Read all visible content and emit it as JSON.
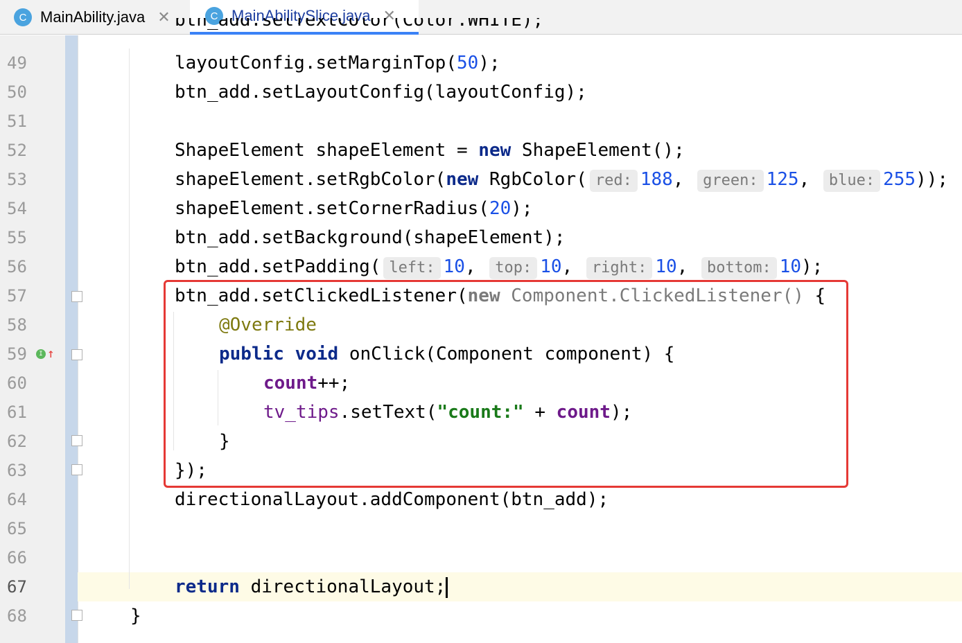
{
  "tabs": [
    {
      "icon": "c-class-icon",
      "icon_letter": "C",
      "label": "MainAbility.java",
      "close": "✕",
      "active": false
    },
    {
      "icon": "c-class-icon",
      "icon_letter": "C",
      "label": "MainAbilitySlice.java",
      "close": "✕",
      "active": true
    }
  ],
  "editor": {
    "current_line": "67",
    "lines": [
      {
        "num": "49"
      },
      {
        "num": "50"
      },
      {
        "num": "51"
      },
      {
        "num": "52"
      },
      {
        "num": "53"
      },
      {
        "num": "54"
      },
      {
        "num": "55"
      },
      {
        "num": "56"
      },
      {
        "num": "57"
      },
      {
        "num": "58"
      },
      {
        "num": "59"
      },
      {
        "num": "60"
      },
      {
        "num": "61"
      },
      {
        "num": "62"
      },
      {
        "num": "63"
      },
      {
        "num": "64"
      },
      {
        "num": "65"
      },
      {
        "num": "66"
      },
      {
        "num": "67"
      },
      {
        "num": "68"
      }
    ],
    "code": {
      "l48": "btn_add.setTextColor(Color.WHITE);",
      "l49a": "layoutConfig.setMarginTop(",
      "l49n": "50",
      "l49b": ");",
      "l50": "btn_add.setLayoutConfig(layoutConfig);",
      "l52a": "ShapeElement shapeElement = ",
      "l52k": "new",
      "l52b": " ShapeElement();",
      "l53a": "shapeElement.setRgbColor(",
      "l53k": "new",
      "l53b": " RgbColor(",
      "l53h1": "red:",
      "l53n1": "188",
      "l53h2": "green:",
      "l53n2": "125",
      "l53h3": "blue:",
      "l53n3": "255",
      "l53c": "));",
      "l54a": "shapeElement.setCornerRadius(",
      "l54n": "20",
      "l54b": ");",
      "l55": "btn_add.setBackground(shapeElement);",
      "l56a": "btn_add.setPadding(",
      "l56h1": "left:",
      "l56n1": "10",
      "l56h2": "top:",
      "l56n2": "10",
      "l56h3": "right:",
      "l56n3": "10",
      "l56h4": "bottom:",
      "l56n4": "10",
      "l56c": ");",
      "l57a": "btn_add.setClickedListener(",
      "l57k": "new",
      "l57g": " Component.ClickedListener()",
      "l57b": " {",
      "l58": "@Override",
      "l59k1": "public",
      "l59k2": "void",
      "l59b": " onClick(Component component) {",
      "l60f": "count",
      "l60b": "++;",
      "l61f": "tv_tips",
      "l61a": ".setText(",
      "l61s": "\"count:\"",
      "l61p": " + ",
      "l61f2": "count",
      "l61b": ");",
      "l62": "}",
      "l63": "});",
      "l64": "directionalLayout.addComponent(btn_add);",
      "l67k": "return",
      "l67b": " directionalLayout;",
      "l68": "}"
    }
  },
  "gutter_markers": {
    "implements_marker": "I",
    "override_arrow": "↑"
  }
}
